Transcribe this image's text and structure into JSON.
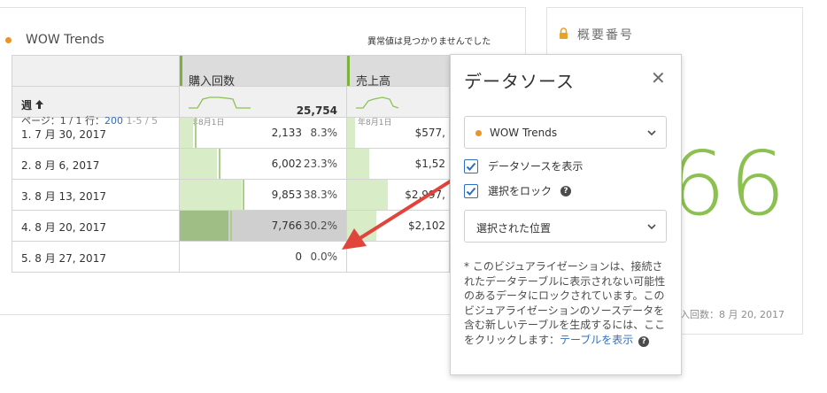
{
  "freeform": {
    "title": "WOW Trends",
    "anomaly_message": "異常値は見つかりませんでした",
    "columns": [
      "購入回数",
      "売上高"
    ],
    "dimension": {
      "label": "週",
      "sort_icon": "arrow-up-icon",
      "pager_prefix": "ページ：1 / 1 行：",
      "rows_per_page": "200",
      "range": "1-5 / 5"
    },
    "summary": {
      "purchases_spark_label": "年8月1日",
      "purchases_total": "25,754",
      "revenue_spark_label": "年8月1日"
    },
    "rows": [
      {
        "label": "1.  7 月 30, 2017",
        "purchases": "2,133",
        "pct": "8.3%",
        "revenue": "$577,"
      },
      {
        "label": "2.  8 月 6, 2017",
        "purchases": "6,002",
        "pct": "23.3%",
        "revenue": "$1,52"
      },
      {
        "label": "3.  8 月 13, 2017",
        "purchases": "9,853",
        "pct": "38.3%",
        "revenue": "$2,997,"
      },
      {
        "label": "4.  8 月 20, 2017",
        "purchases": "7,766",
        "pct": "30.2%",
        "revenue": "$2,102"
      },
      {
        "label": "5.  8 月 27, 2017",
        "purchases": "0",
        "pct": "0.0%",
        "revenue": ""
      }
    ],
    "bar_fractions": [
      0.083,
      0.233,
      0.383,
      0.302,
      0.0
    ],
    "revenue_fractions": [
      0.08,
      0.22,
      0.4,
      0.29,
      0.0
    ]
  },
  "summary_number": {
    "title": "概要番号",
    "lock_icon": "lock-icon",
    "value": "66",
    "footer": "入回数：8 月 20, 2017"
  },
  "popover": {
    "title": "データソース",
    "close_icon": "close-icon",
    "source_select": "WOW Trends",
    "show_source_label": "データソースを表示",
    "show_source_checked": true,
    "lock_selection_label": "選択をロック",
    "lock_selection_checked": true,
    "position_select": "選択された位置",
    "note": "* このビジュアライゼーションは、接続されたデータテーブルに表示されない可能性のあるデータにロックされています。このビジュアライゼーションのソースデータを含む新しいテーブルを生成するには、ここをクリックします：",
    "note_link": "テーブルを表示"
  },
  "colors": {
    "accent_green": "#8cc152",
    "bar_green": "#d7ecc7",
    "source_dot": "#e99529",
    "link_blue": "#2f6fc0",
    "arrow_red": "#e0443a"
  }
}
